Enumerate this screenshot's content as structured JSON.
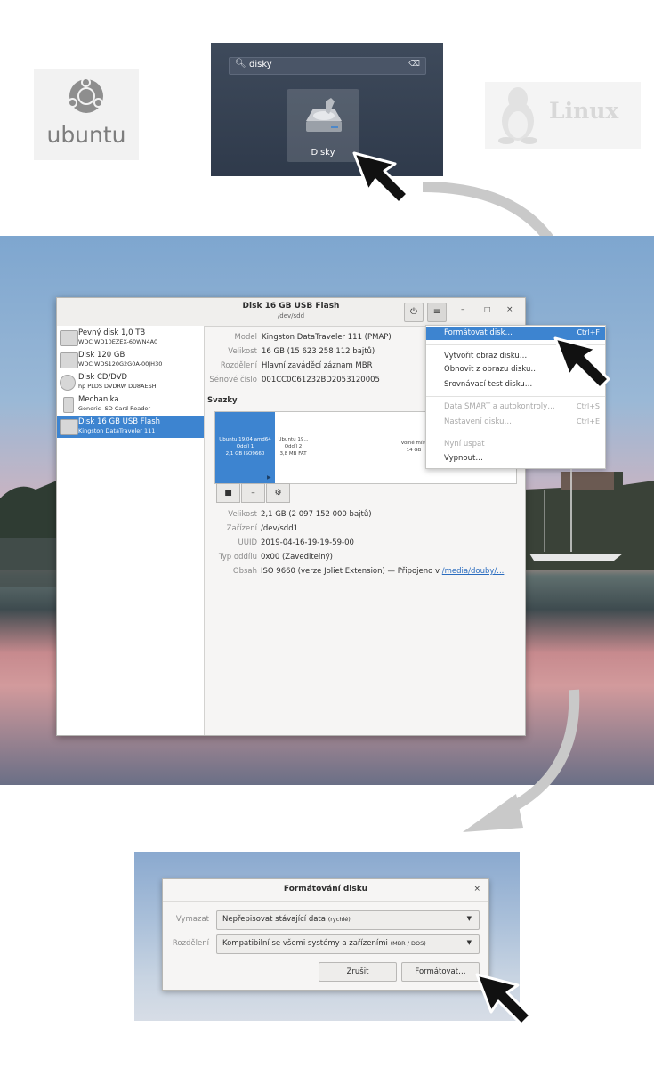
{
  "launcher": {
    "search_value": "disky",
    "app_label": "Disky"
  },
  "logos": {
    "ubuntu": "ubuntu",
    "linux": "Linux"
  },
  "window": {
    "title": "Disk 16 GB USB Flash",
    "subtitle": "/dev/sdd"
  },
  "disks": [
    {
      "name": "Pevný disk 1,0 TB",
      "model": "WDC WD10EZEX-60WN4A0"
    },
    {
      "name": "Disk 120 GB",
      "model": "WDC WDS120G2G0A-00JH30"
    },
    {
      "name": "Disk CD/DVD",
      "model": "hp PLDS DVDRW DU8AESH"
    },
    {
      "name": "Mechanika",
      "model": "Generic- SD Card Reader"
    },
    {
      "name": "Disk 16 GB USB Flash",
      "model": "Kingston DataTraveler 111"
    }
  ],
  "info": {
    "model_label": "Model",
    "model": "Kingston DataTraveler 111 (PMAP)",
    "size_label": "Velikost",
    "size": "16 GB (15 623 258 112 bajtů)",
    "partitioning_label": "Rozdělení",
    "partitioning": "Hlavní zaváděcí záznam MBR",
    "serial_label": "Sériové číslo",
    "serial": "001CC0C61232BD2053120005"
  },
  "volumes_heading": "Svazky",
  "volumes": {
    "v1_name": "Ubuntu 19.04 amd64",
    "v1_part": "Oddíl 1",
    "v1_size": "2,1 GB ISO9660",
    "v2_name": "Ubuntu 19...",
    "v2_part": "Oddíl 2",
    "v2_size": "3,8 MB FAT",
    "v3_name": "Volné míst",
    "v3_size": "14 GB"
  },
  "volume_info": {
    "size_label": "Velikost",
    "size": "2,1 GB (2 097 152 000 bajtů)",
    "device_label": "Zařízení",
    "device": "/dev/sdd1",
    "uuid_label": "UUID",
    "uuid": "2019-04-16-19-19-59-00",
    "type_label": "Typ oddílu",
    "type": "0x00 (Zaveditelný)",
    "contents_label": "Obsah",
    "contents": "ISO 9660 (verze Joliet Extension) — Připojeno v",
    "mount_link": "/media/douby/..."
  },
  "menu": {
    "format": "Formátovat disk…",
    "format_shortcut": "Ctrl+F",
    "create_image": "Vytvořit obraz disku…",
    "restore_image": "Obnovit z obrazu disku…",
    "benchmark": "Srovnávací test disku…",
    "smart": "Data SMART a autokontroly…",
    "smart_shortcut": "Ctrl+S",
    "settings": "Nastavení disku…",
    "settings_shortcut": "Ctrl+E",
    "sleep": "Nyní uspat",
    "power_off": "Vypnout…"
  },
  "dialog": {
    "title": "Formátování disku",
    "erase_label": "Vymazat",
    "erase_value": "Nepřepisovat stávající data",
    "erase_hint": "(rychlé)",
    "partitioning_label": "Rozdělení",
    "partitioning_value": "Kompatibilní se všemi systémy a zařízeními",
    "partitioning_hint": "(MBR / DOS)",
    "cancel": "Zrušit",
    "format": "Formátovat…"
  }
}
